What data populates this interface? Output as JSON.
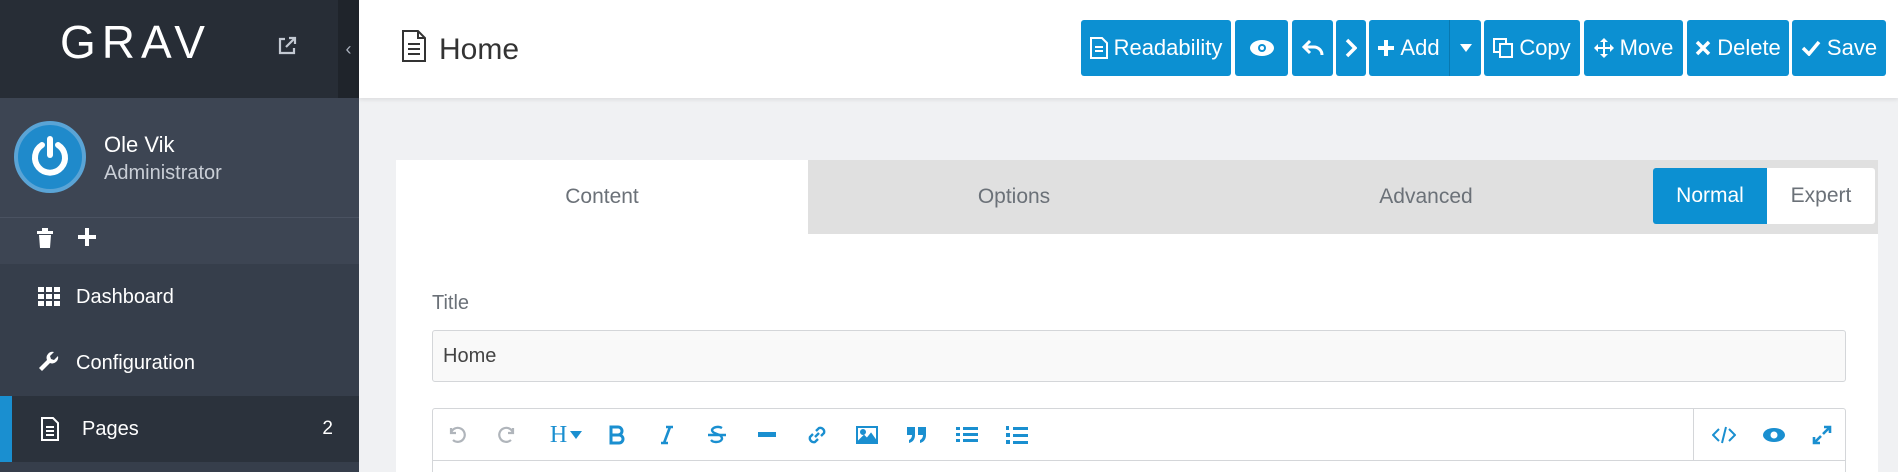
{
  "sidebar": {
    "logo_text": "GRAV",
    "collapse_glyph": "‹",
    "user": {
      "name": "Ole Vik",
      "role": "Administrator"
    },
    "nav": [
      {
        "label": "Dashboard",
        "icon": "grid-icon"
      },
      {
        "label": "Configuration",
        "icon": "wrench-icon"
      },
      {
        "label": "Pages",
        "icon": "file-icon",
        "count": "2",
        "active": true
      }
    ]
  },
  "header": {
    "title": "Home",
    "buttons": {
      "readability": "Readability",
      "add": "Add",
      "copy": "Copy",
      "move": "Move",
      "delete": "Delete",
      "save": "Save"
    }
  },
  "tabs": [
    "Content",
    "Options",
    "Advanced"
  ],
  "modes": {
    "normal": "Normal",
    "expert": "Expert"
  },
  "form": {
    "title_label": "Title",
    "title_value": "Home"
  },
  "editor": {
    "heading_glyph": "H"
  },
  "colors": {
    "accent": "#0c90d2",
    "sidebar_bg": "#363e4b",
    "logo_bg": "#272d36"
  }
}
